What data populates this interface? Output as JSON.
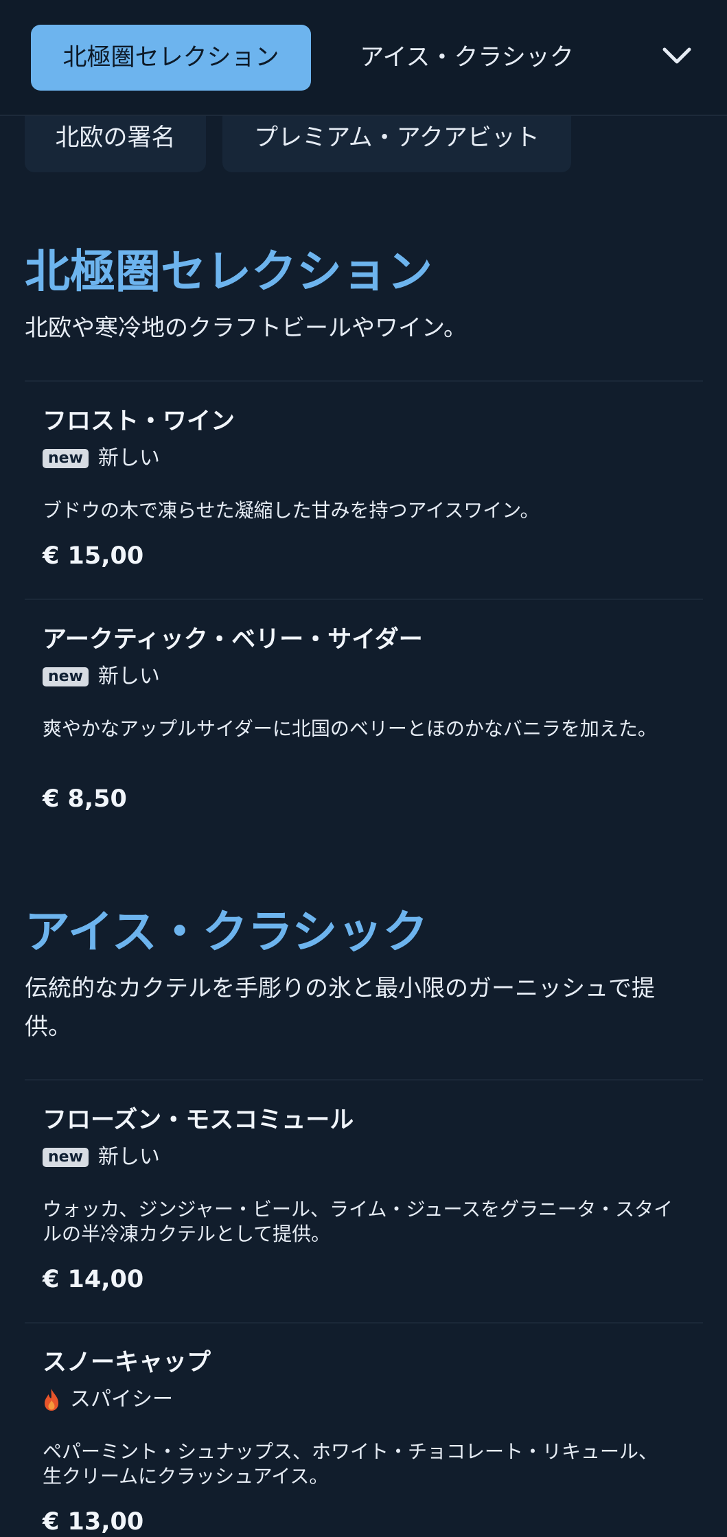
{
  "nav": {
    "tabs": [
      {
        "label": "北極圏セレクション",
        "active": true
      },
      {
        "label": "アイス・クラシック",
        "active": false
      }
    ],
    "chevron_icon": "chevron-down-icon",
    "subtabs": [
      {
        "label": "北欧の署名"
      },
      {
        "label": "プレミアム・アクアビット"
      }
    ]
  },
  "colors": {
    "accent": "#6db4ee",
    "background": "#111d2c",
    "badge": "#d7dce3",
    "flame": "#e8552b"
  },
  "sections": [
    {
      "title": "北極圏セレクション",
      "description": "北欧や寒冷地のクラフトビールやワイン。",
      "items": [
        {
          "name": "フロスト・ワイン",
          "badge": "new",
          "tag": "新しい",
          "description": "ブドウの木で凍らせた凝縮した甘みを持つアイスワイン。",
          "price": "€ 15,00"
        },
        {
          "name": "アークティック・ベリー・サイダー",
          "badge": "new",
          "tag": "新しい",
          "description": "爽やかなアップルサイダーに北国のベリーとほのかなバニラを加えた。",
          "price": "€ 8,50"
        }
      ]
    },
    {
      "title": "アイス・クラシック",
      "description": "伝統的なカクテルを手彫りの氷と最小限のガーニッシュで提供。",
      "items": [
        {
          "name": "フローズン・モスコミュール",
          "badge": "new",
          "tag": "新しい",
          "description": "ウォッカ、ジンジャー・ビール、ライム・ジュースをグラニータ・スタイルの半冷凍カクテルとして提供。",
          "price": "€ 14,00"
        },
        {
          "name": "スノーキャップ",
          "icon": "flame-icon",
          "tag": "スパイシー",
          "description": "ペパーミント・シュナップス、ホワイト・チョコレート・リキュール、生クリームにクラッシュアイス。",
          "price": "€ 13,00"
        }
      ]
    }
  ]
}
